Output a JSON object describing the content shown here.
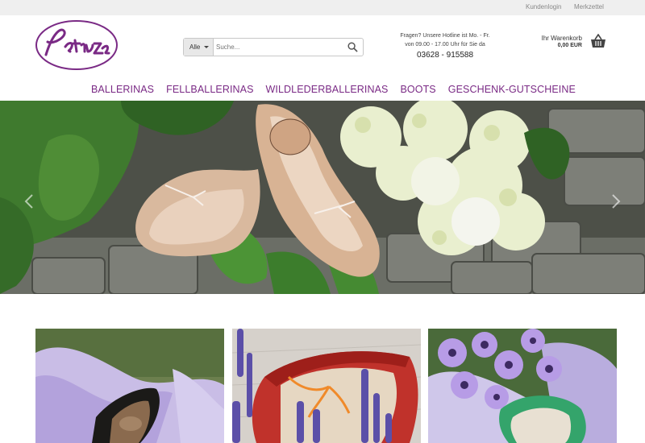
{
  "topbar": {
    "login_label": "Kundenlogin",
    "wishlist_label": "Merkzettel"
  },
  "logo": {
    "text": "Petruschka"
  },
  "search": {
    "category": "Alle",
    "placeholder": "Suche..."
  },
  "hotline": {
    "line1": "Fragen? Unsere Hotline ist Mo. - Fr.",
    "line2": "von 09.00 - 17.00 Uhr für Sie da",
    "phone": "03628 - 915588"
  },
  "cart": {
    "label": "Ihr Warenkorb",
    "total": "0,00 EUR"
  },
  "nav": {
    "items": [
      "BALLERINAS",
      "FELLBALLERINAS",
      "WILDLEDERBALLERINAS",
      "BOOTS",
      "GESCHENK-GUTSCHEINE"
    ]
  },
  "colors": {
    "brand": "#7a2a85",
    "topbar": "#efefef"
  }
}
